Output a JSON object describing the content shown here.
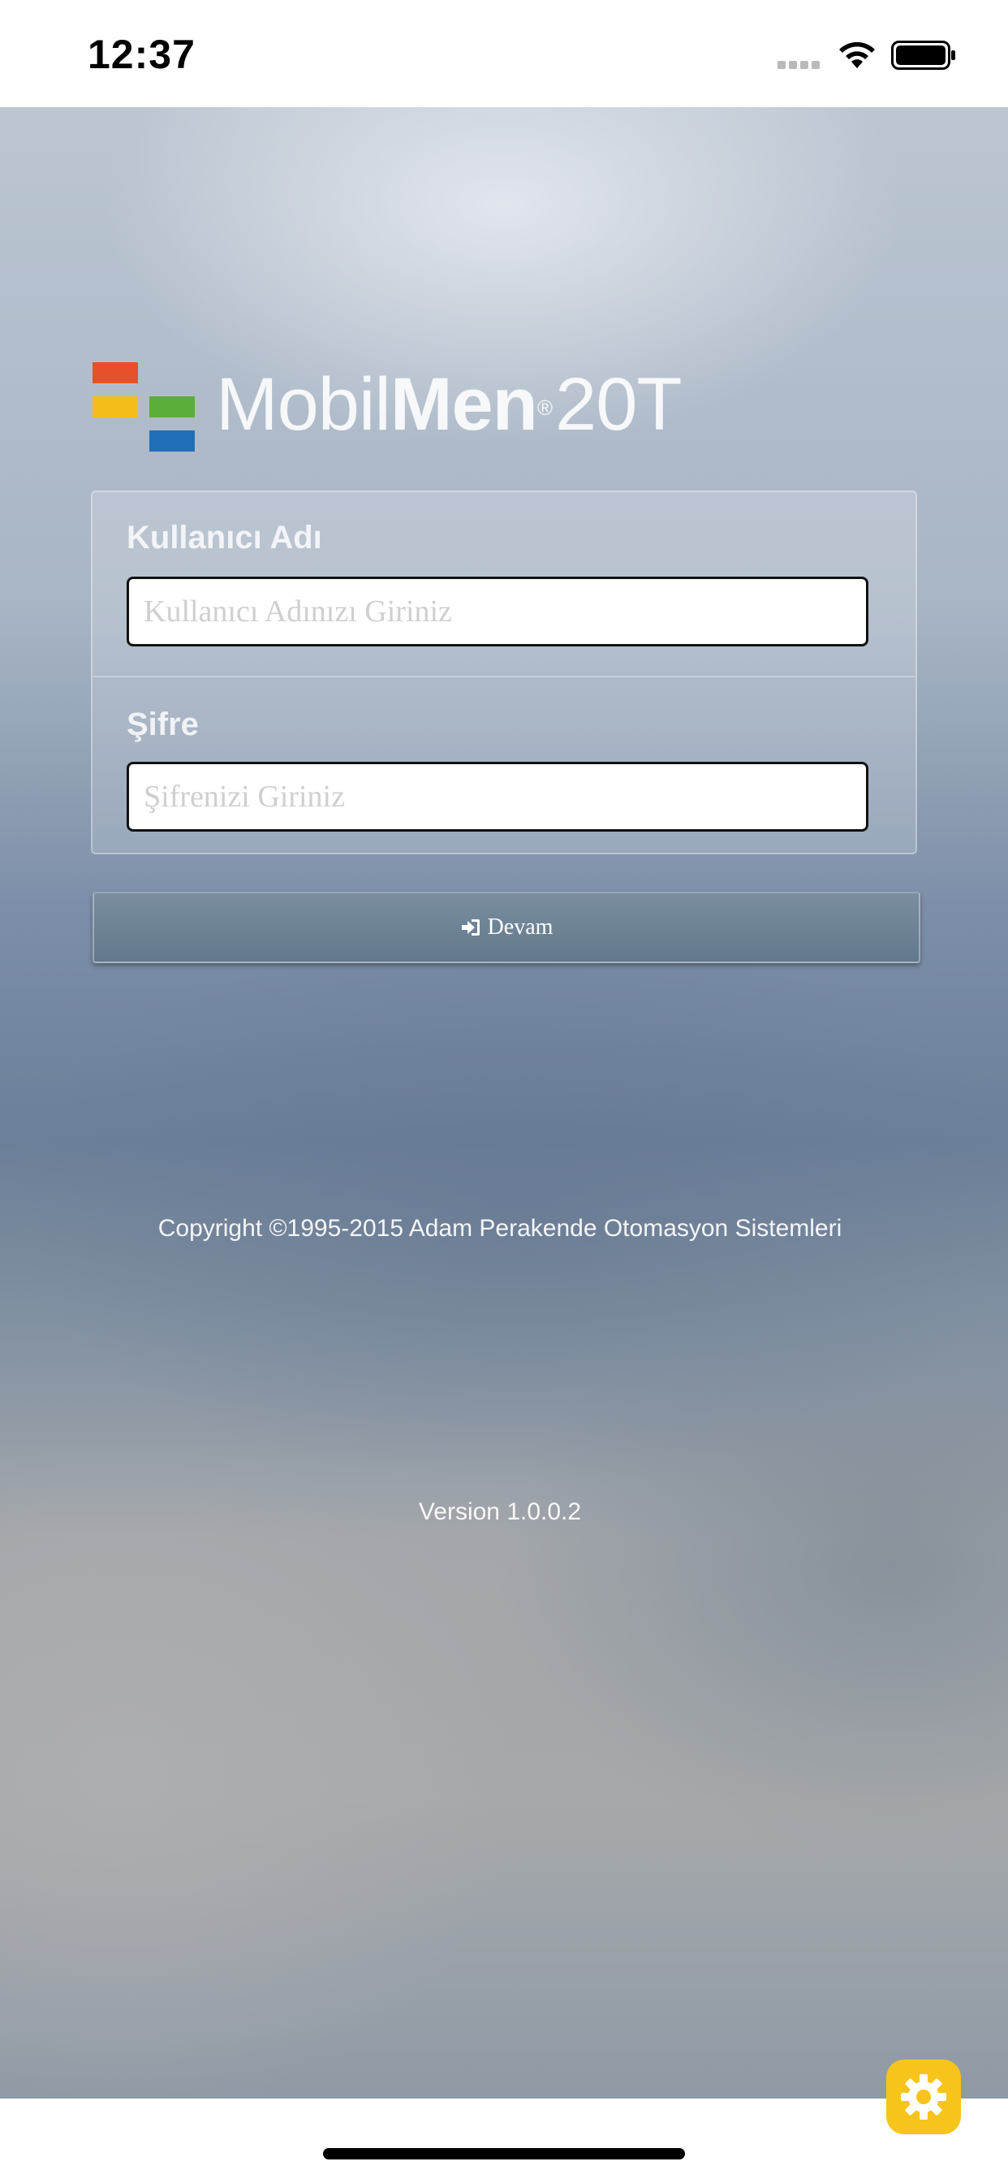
{
  "status_bar": {
    "time": "12:37"
  },
  "logo": {
    "text_light": "Mobil",
    "text_bold": "Men",
    "registered": "®",
    "text_suffix": "20T",
    "brand_colors": [
      "#e8502a",
      "#f4bd1a",
      "#5cae3a",
      "#1f6fb8"
    ]
  },
  "login_form": {
    "username_label": "Kullanıcı Adı",
    "username_placeholder": "Kullanıcı Adınızı Giriniz",
    "username_value": "",
    "password_label": "Şifre",
    "password_placeholder": "Şifrenizi Giriniz",
    "password_value": "",
    "continue_label": "Devam",
    "continue_icon": "sign-in-icon"
  },
  "footer": {
    "copyright": "Copyright ©1995-2015 Adam Perakende Otomasyon Sistemleri",
    "version": "Version 1.0.0.2"
  },
  "settings": {
    "icon": "gear-icon",
    "color": "#f7c41b"
  }
}
